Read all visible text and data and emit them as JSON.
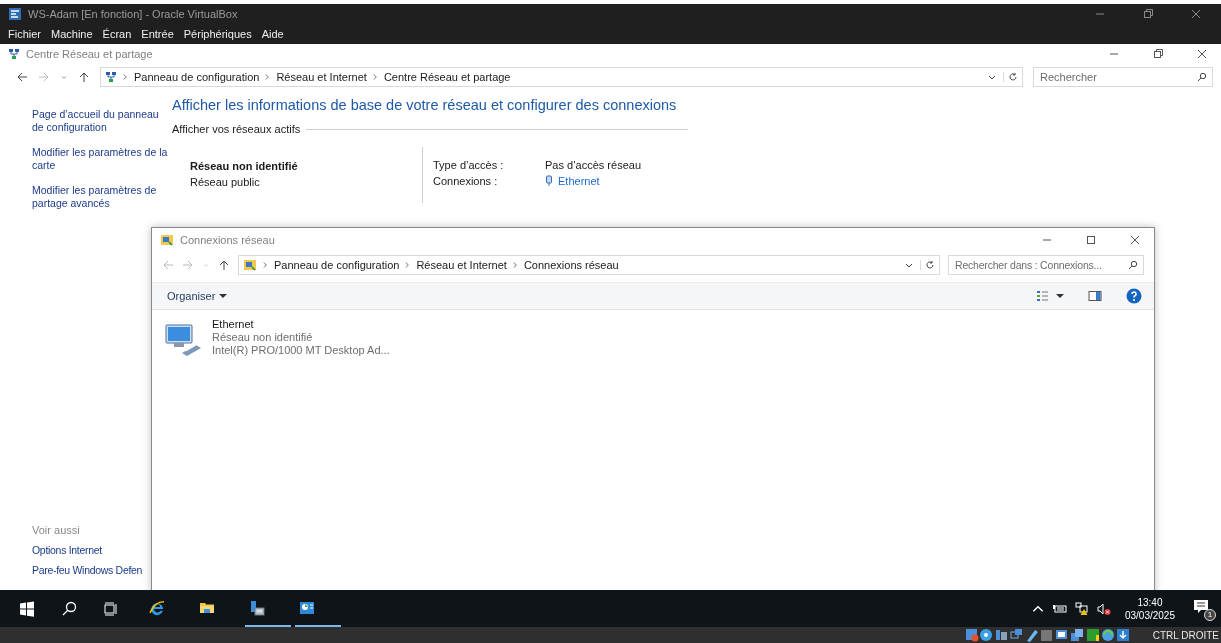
{
  "vm_window": {
    "title": "WS-Adam [En fonction] - Oracle VirtualBox",
    "menu": [
      "Fichier",
      "Machine",
      "Écran",
      "Entrée",
      "Périphériques",
      "Aide"
    ]
  },
  "network_center": {
    "title": "Centre Réseau et partage",
    "breadcrumb": [
      "Panneau de configuration",
      "Réseau et Internet",
      "Centre Réseau et partage"
    ],
    "search": {
      "placeholder": "Rechercher"
    },
    "sidebar_links": [
      "Page d’accueil du panneau de configuration",
      "Modifier les paramètres de la carte",
      "Modifier les paramètres de partage avancés"
    ],
    "see_also": {
      "heading": "Voir aussi",
      "links": [
        "Options Internet",
        "Pare-feu Windows Defen"
      ]
    },
    "heading": "Afficher les informations de base de votre réseau et configurer des connexions",
    "active_networks_label": "Afficher vos réseaux actifs",
    "network": {
      "name": "Réseau non identifié",
      "category": "Réseau public",
      "access_type_label": "Type d’accès :",
      "access_type": "Pas d’accès réseau",
      "connections_label": "Connexions :",
      "connection": "Ethernet"
    }
  },
  "connections_window": {
    "title": "Connexions réseau",
    "breadcrumb": [
      "Panneau de configuration",
      "Réseau et Internet",
      "Connexions réseau"
    ],
    "search": {
      "placeholder": "Rechercher dans : Connexions..."
    },
    "organize": "Organiser",
    "adapters": [
      {
        "name": "Ethernet",
        "status": "Réseau non identifié",
        "device": "Intel(R) PRO/1000 MT Desktop Ad..."
      }
    ]
  },
  "taskbar": {
    "apps": [
      {
        "kind": "ie",
        "running": false
      },
      {
        "kind": "explorer",
        "running": false
      },
      {
        "kind": "server",
        "running": true
      },
      {
        "kind": "network",
        "running": true
      }
    ],
    "time": "13:40",
    "date": "03/03/2025",
    "notification_count": "1"
  },
  "status_bar": {
    "host_key": "CTRL DROITE"
  }
}
